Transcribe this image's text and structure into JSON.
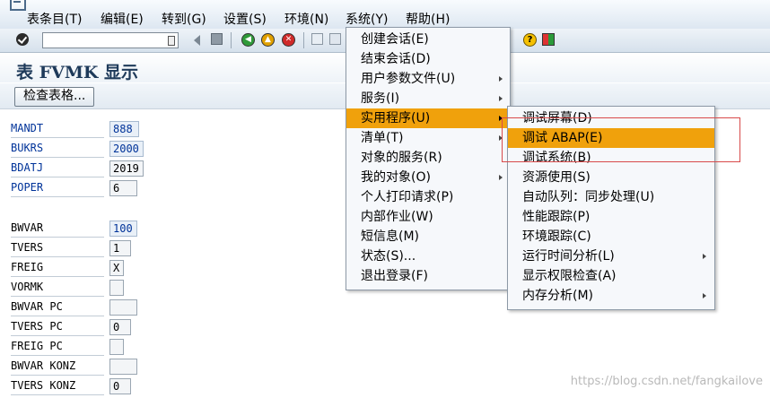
{
  "menubar": {
    "items": [
      "表条目(T)",
      "编辑(E)",
      "转到(G)",
      "设置(S)",
      "环境(N)",
      "系统(Y)",
      "帮助(H)"
    ]
  },
  "toolbar": {
    "command_field": {
      "value": "",
      "placeholder": ""
    },
    "icons": [
      "enter-icon",
      "back-icon",
      "save-icon",
      "back-nav-icon",
      "exit-icon",
      "cancel-icon",
      "print-icon",
      "find-icon",
      "help-icon",
      "layout-icon"
    ]
  },
  "title": "表 FVMK 显示",
  "app_toolbar": {
    "check_button": "检查表格..."
  },
  "fields": {
    "mandt": {
      "label": "MANDT",
      "value": "888"
    },
    "bukrs": {
      "label": "BUKRS",
      "value": "2000"
    },
    "bdatj": {
      "label": "BDATJ",
      "value": "2019"
    },
    "poper": {
      "label": "POPER",
      "value": "6"
    },
    "bwvar": {
      "label": "BWVAR",
      "value": "100"
    },
    "tvers": {
      "label": "TVERS",
      "value": "1"
    },
    "freig": {
      "label": "FREIG",
      "value": "X"
    },
    "vormk": {
      "label": "VORMK",
      "value": ""
    },
    "bwvar_pc": {
      "label": "BWVAR PC",
      "value": ""
    },
    "tvers_pc": {
      "label": "TVERS PC",
      "value": "0"
    },
    "freig_pc": {
      "label": "FREIG PC",
      "value": ""
    },
    "bwvar_konz": {
      "label": "BWVAR KONZ",
      "value": ""
    },
    "tvers_konz": {
      "label": "TVERS KONZ",
      "value": "0"
    }
  },
  "system_menu": {
    "items": [
      "创建会话(E)",
      "结束会话(D)",
      "用户参数文件(U)",
      "服务(I)",
      "实用程序(U)",
      "清单(T)",
      "对象的服务(R)",
      "我的对象(O)",
      "个人打印请求(P)",
      "内部作业(W)",
      "短信息(M)",
      "状态(S)...",
      "退出登录(F)"
    ],
    "active": "实用程序(U)"
  },
  "utilities_menu": {
    "items": [
      "调试屏幕(D)",
      "调试 ABAP(E)",
      "调试系统(B)",
      "资源使用(S)",
      "自动队列：同步处理(U)",
      "性能跟踪(P)",
      "环境跟踪(C)",
      "运行时间分析(L)",
      "显示权限检查(A)",
      "内存分析(M)"
    ],
    "active": "调试 ABAP(E)"
  },
  "colors": {
    "highlight": "#f0a10c",
    "annotation_box": "#d84a4a",
    "key_field": "#003399"
  },
  "watermark": "https://blog.csdn.net/fangkailove"
}
